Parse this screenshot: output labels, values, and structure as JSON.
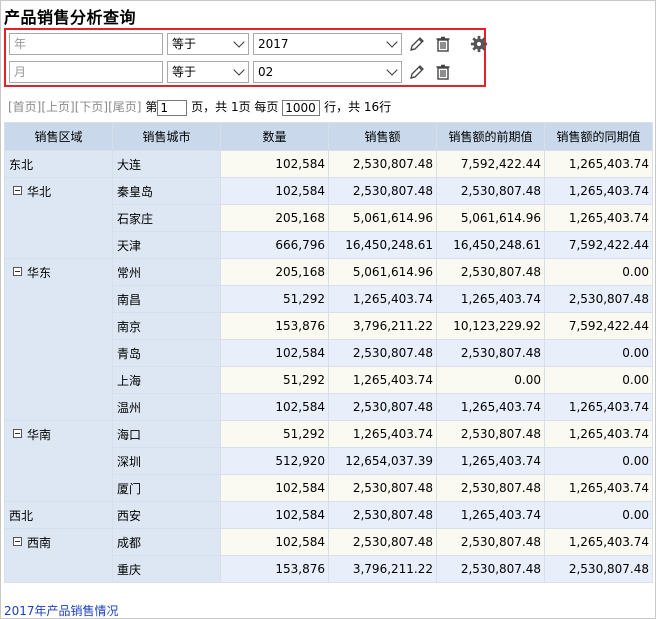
{
  "page_title": "产品销售分析查询",
  "filters": [
    {
      "field_placeholder": "年",
      "operator": "等于",
      "value": "2017"
    },
    {
      "field_placeholder": "月",
      "operator": "等于",
      "value": "02"
    }
  ],
  "icons": {
    "edit": "pencil-icon",
    "delete": "trash-icon",
    "settings": "gear-icon"
  },
  "pager": {
    "first": "[首页]",
    "prev": "[上页]",
    "next": "[下页]",
    "last": "[尾页]",
    "page_prefix": "第",
    "page_value": "1",
    "page_suffix": "页，共 1页 每页",
    "per_page_value": "1000",
    "rows_suffix": "行，共 16行"
  },
  "table": {
    "headers": [
      "销售区域",
      "销售城市",
      "数量",
      "销售额",
      "销售额的前期值",
      "销售额的同期值"
    ],
    "rows": [
      {
        "region": "东北",
        "collapsible": false,
        "city": "大连",
        "qty": "102,584",
        "sales": "2,530,807.48",
        "prev": "7,592,422.44",
        "yoy": "1,265,403.74"
      },
      {
        "region": "华北",
        "collapsible": true,
        "city": "秦皇岛",
        "qty": "102,584",
        "sales": "2,530,807.48",
        "prev": "2,530,807.48",
        "yoy": "1,265,403.74"
      },
      {
        "region": "",
        "collapsible": false,
        "city": "石家庄",
        "qty": "205,168",
        "sales": "5,061,614.96",
        "prev": "5,061,614.96",
        "yoy": "1,265,403.74"
      },
      {
        "region": "",
        "collapsible": false,
        "city": "天津",
        "qty": "666,796",
        "sales": "16,450,248.61",
        "prev": "16,450,248.61",
        "yoy": "7,592,422.44"
      },
      {
        "region": "华东",
        "collapsible": true,
        "city": "常州",
        "qty": "205,168",
        "sales": "5,061,614.96",
        "prev": "2,530,807.48",
        "yoy": "0.00"
      },
      {
        "region": "",
        "collapsible": false,
        "city": "南昌",
        "qty": "51,292",
        "sales": "1,265,403.74",
        "prev": "1,265,403.74",
        "yoy": "2,530,807.48"
      },
      {
        "region": "",
        "collapsible": false,
        "city": "南京",
        "qty": "153,876",
        "sales": "3,796,211.22",
        "prev": "10,123,229.92",
        "yoy": "7,592,422.44"
      },
      {
        "region": "",
        "collapsible": false,
        "city": "青岛",
        "qty": "102,584",
        "sales": "2,530,807.48",
        "prev": "2,530,807.48",
        "yoy": "0.00"
      },
      {
        "region": "",
        "collapsible": false,
        "city": "上海",
        "qty": "51,292",
        "sales": "1,265,403.74",
        "prev": "0.00",
        "yoy": "0.00"
      },
      {
        "region": "",
        "collapsible": false,
        "city": "温州",
        "qty": "102,584",
        "sales": "2,530,807.48",
        "prev": "1,265,403.74",
        "yoy": "1,265,403.74"
      },
      {
        "region": "华南",
        "collapsible": true,
        "city": "海口",
        "qty": "51,292",
        "sales": "1,265,403.74",
        "prev": "2,530,807.48",
        "yoy": "1,265,403.74"
      },
      {
        "region": "",
        "collapsible": false,
        "city": "深圳",
        "qty": "512,920",
        "sales": "12,654,037.39",
        "prev": "1,265,403.74",
        "yoy": "0.00"
      },
      {
        "region": "",
        "collapsible": false,
        "city": "厦门",
        "qty": "102,584",
        "sales": "2,530,807.48",
        "prev": "2,530,807.48",
        "yoy": "1,265,403.74"
      },
      {
        "region": "西北",
        "collapsible": false,
        "city": "西安",
        "qty": "102,584",
        "sales": "2,530,807.48",
        "prev": "1,265,403.74",
        "yoy": "0.00"
      },
      {
        "region": "西南",
        "collapsible": true,
        "city": "成都",
        "qty": "102,584",
        "sales": "2,530,807.48",
        "prev": "2,530,807.48",
        "yoy": "1,265,403.74"
      },
      {
        "region": "",
        "collapsible": false,
        "city": "重庆",
        "qty": "153,876",
        "sales": "3,796,211.22",
        "prev": "2,530,807.48",
        "yoy": "2,530,807.48"
      }
    ]
  },
  "footer_link": "2017年产品销售情况",
  "colors": {
    "filter_border": "#e0232b",
    "header_bg": "#c9d9eb",
    "link": "#1a3fc4"
  }
}
